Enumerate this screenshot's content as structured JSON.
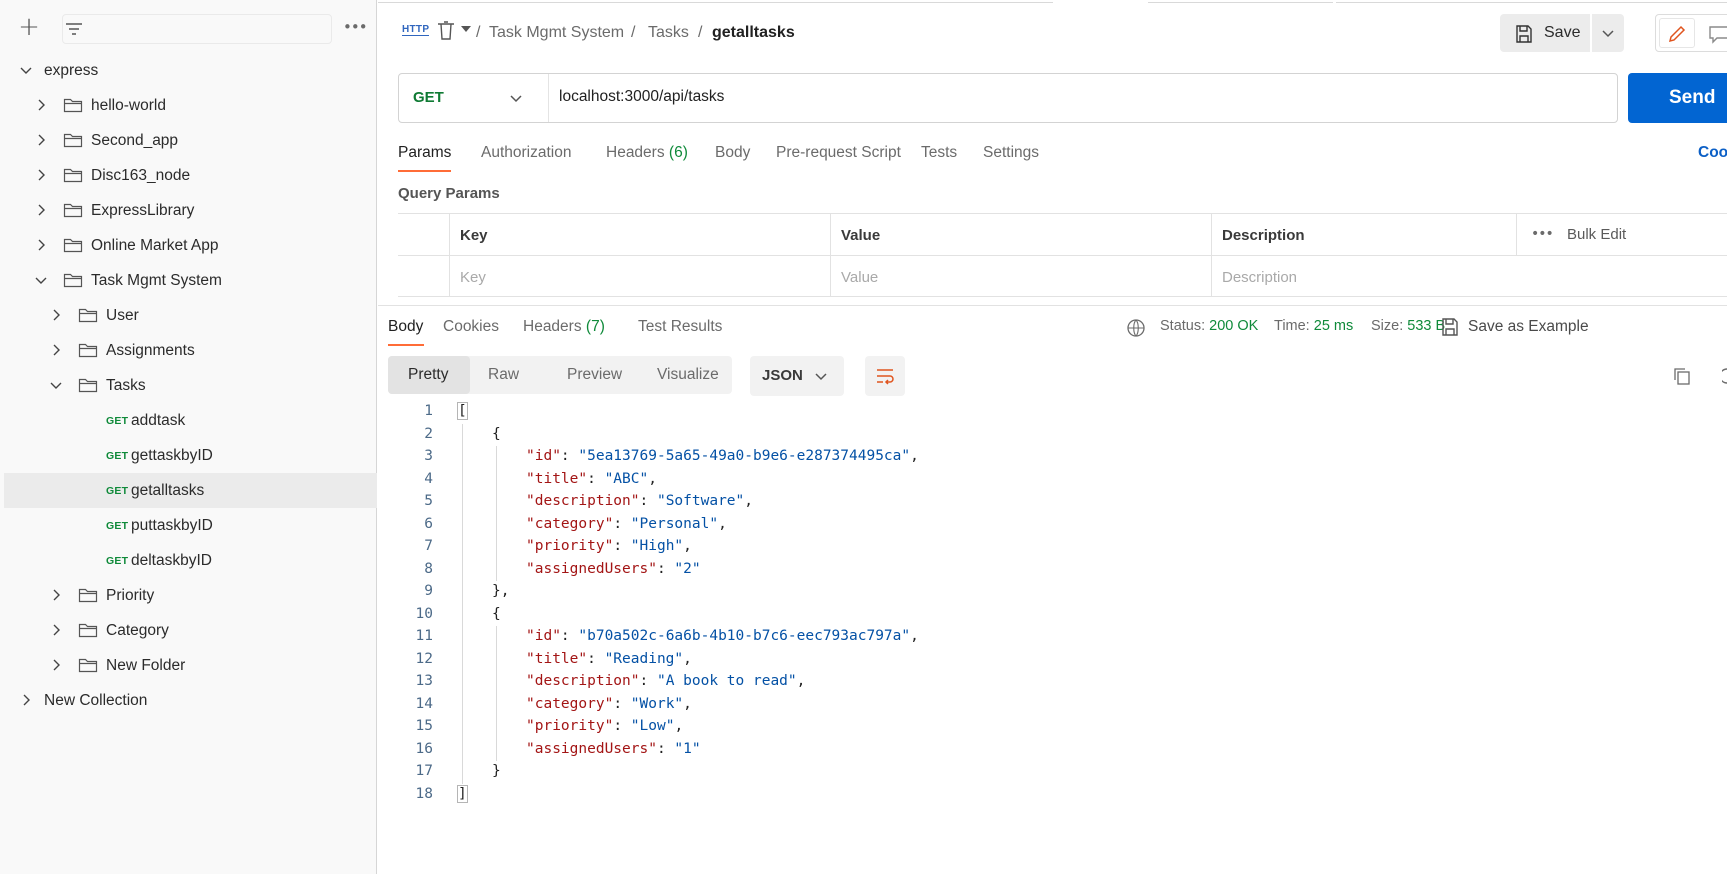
{
  "sidebar": {
    "toolbar": {
      "add_icon": "plus-icon",
      "filter_icon": "filter-icon",
      "more_icon": "more-dots-icon"
    },
    "tree": [
      {
        "label": "express",
        "level": 0,
        "expanded": true,
        "type": "collection"
      },
      {
        "label": "hello-world",
        "level": 1,
        "expanded": false,
        "type": "folder"
      },
      {
        "label": "Second_app",
        "level": 1,
        "expanded": false,
        "type": "folder"
      },
      {
        "label": "Disc163_node",
        "level": 1,
        "expanded": false,
        "type": "folder"
      },
      {
        "label": "ExpressLibrary",
        "level": 1,
        "expanded": false,
        "type": "folder"
      },
      {
        "label": "Online Market App",
        "level": 1,
        "expanded": false,
        "type": "folder"
      },
      {
        "label": "Task Mgmt System",
        "level": 1,
        "expanded": true,
        "type": "folder"
      },
      {
        "label": "User",
        "level": 2,
        "expanded": false,
        "type": "folder"
      },
      {
        "label": "Assignments",
        "level": 2,
        "expanded": false,
        "type": "folder"
      },
      {
        "label": "Tasks",
        "level": 2,
        "expanded": true,
        "type": "folder"
      },
      {
        "label": "addtask",
        "level": 3,
        "type": "request",
        "method": "GET"
      },
      {
        "label": "gettaskbyID",
        "level": 3,
        "type": "request",
        "method": "GET"
      },
      {
        "label": "getalltasks",
        "level": 3,
        "type": "request",
        "method": "GET",
        "selected": true
      },
      {
        "label": "puttaskbyID",
        "level": 3,
        "type": "request",
        "method": "GET"
      },
      {
        "label": "deltaskbyID",
        "level": 3,
        "type": "request",
        "method": "GET"
      },
      {
        "label": "Priority",
        "level": 2,
        "expanded": false,
        "type": "folder"
      },
      {
        "label": "Category",
        "level": 2,
        "expanded": false,
        "type": "folder"
      },
      {
        "label": "New Folder",
        "level": 2,
        "expanded": false,
        "type": "folder"
      },
      {
        "label": "New Collection",
        "level": 0,
        "expanded": false,
        "type": "collection"
      }
    ]
  },
  "header": {
    "http_label": "HTTP",
    "breadcrumb": [
      "Task Mgmt System",
      "Tasks",
      "getalltasks"
    ],
    "separator": "/",
    "save_label": "Save"
  },
  "request": {
    "method": "GET",
    "url": "localhost:3000/api/tasks",
    "send_label": "Send",
    "tabs": [
      {
        "label": "Params",
        "count": "",
        "active": true
      },
      {
        "label": "Authorization",
        "count": ""
      },
      {
        "label": "Headers",
        "count": "(6)"
      },
      {
        "label": "Body",
        "count": ""
      },
      {
        "label": "Pre-request Script",
        "count": ""
      },
      {
        "label": "Tests",
        "count": ""
      },
      {
        "label": "Settings",
        "count": ""
      }
    ],
    "cookies_label": "Cookie",
    "query_params": {
      "title": "Query Params",
      "columns": [
        "Key",
        "Value",
        "Description"
      ],
      "placeholders": [
        "Key",
        "Value",
        "Description"
      ],
      "bulk_edit_label": "Bulk Edit"
    }
  },
  "response": {
    "tabs": [
      {
        "label": "Body",
        "count": "",
        "active": true
      },
      {
        "label": "Cookies",
        "count": ""
      },
      {
        "label": "Headers",
        "count": "(7)"
      },
      {
        "label": "Test Results",
        "count": ""
      }
    ],
    "status_label": "Status:",
    "status_value": "200 OK",
    "time_label": "Time:",
    "time_value": "25 ms",
    "size_label": "Size:",
    "size_value": "533 B",
    "save_example_label": "Save as Example",
    "view_modes": [
      "Pretty",
      "Raw",
      "Preview",
      "Visualize"
    ],
    "active_view": "Pretty",
    "format": "JSON",
    "lines": [
      {
        "n": "1",
        "indent": 0,
        "text": "["
      },
      {
        "n": "2",
        "indent": 1,
        "text": "{"
      },
      {
        "n": "3",
        "indent": 2,
        "key": "\"id\"",
        "value": "\"5ea13769-5a65-49a0-b9e6-e287374495ca\"",
        "comma": true
      },
      {
        "n": "4",
        "indent": 2,
        "key": "\"title\"",
        "value": "\"ABC\"",
        "comma": true
      },
      {
        "n": "5",
        "indent": 2,
        "key": "\"description\"",
        "value": "\"Software\"",
        "comma": true
      },
      {
        "n": "6",
        "indent": 2,
        "key": "\"category\"",
        "value": "\"Personal\"",
        "comma": true
      },
      {
        "n": "7",
        "indent": 2,
        "key": "\"priority\"",
        "value": "\"High\"",
        "comma": true
      },
      {
        "n": "8",
        "indent": 2,
        "key": "\"assignedUsers\"",
        "value": "\"2\"",
        "comma": false
      },
      {
        "n": "9",
        "indent": 1,
        "text": "},"
      },
      {
        "n": "10",
        "indent": 1,
        "text": "{"
      },
      {
        "n": "11",
        "indent": 2,
        "key": "\"id\"",
        "value": "\"b70a502c-6a6b-4b10-b7c6-eec793ac797a\"",
        "comma": true
      },
      {
        "n": "12",
        "indent": 2,
        "key": "\"title\"",
        "value": "\"Reading\"",
        "comma": true
      },
      {
        "n": "13",
        "indent": 2,
        "key": "\"description\"",
        "value": "\"A book to read\"",
        "comma": true
      },
      {
        "n": "14",
        "indent": 2,
        "key": "\"category\"",
        "value": "\"Work\"",
        "comma": true
      },
      {
        "n": "15",
        "indent": 2,
        "key": "\"priority\"",
        "value": "\"Low\"",
        "comma": true
      },
      {
        "n": "16",
        "indent": 2,
        "key": "\"assignedUsers\"",
        "value": "\"1\"",
        "comma": false
      },
      {
        "n": "17",
        "indent": 1,
        "text": "}"
      },
      {
        "n": "18",
        "indent": 0,
        "text": "]"
      }
    ]
  },
  "colors": {
    "accent": "#ff6c37",
    "send": "#0265d2",
    "get_method": "#0f7a34",
    "json_key": "#a31515",
    "json_string": "#0451a5"
  }
}
